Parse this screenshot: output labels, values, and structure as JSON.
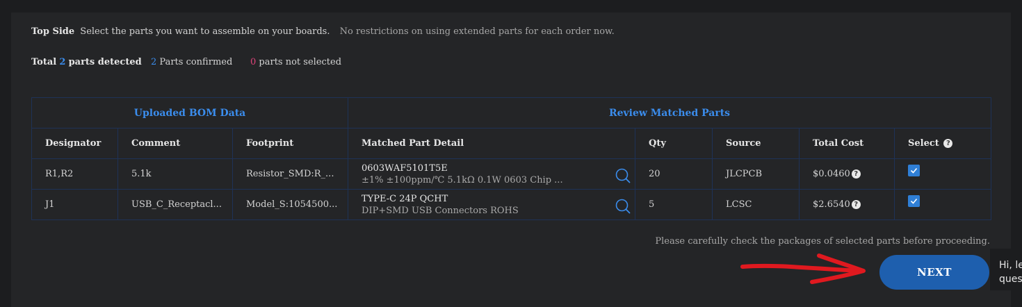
{
  "header": {
    "side": "Top Side",
    "instruction": "Select the parts you want to assemble on your boards.",
    "note": "No restrictions on using extended parts for each order now."
  },
  "summary": {
    "total_prefix": "Total",
    "total_count": "2",
    "total_suffix": "parts detected",
    "confirmed_count": "2",
    "confirmed_label": "Parts confirmed",
    "not_selected_count": "0",
    "not_selected_label": "parts not selected"
  },
  "table": {
    "group_left": "Uploaded BOM Data",
    "group_right": "Review Matched Parts",
    "columns": [
      "Designator",
      "Comment",
      "Footprint",
      "Matched Part Detail",
      "Qty",
      "Source",
      "Total Cost",
      "Select"
    ],
    "rows": [
      {
        "designator": "R1,R2",
        "comment": "5.1k",
        "footprint": "Resistor_SMD:R_...",
        "part_title": "0603WAF5101T5E",
        "part_desc": "±1% ±100ppm/℃ 5.1kΩ 0.1W 0603 Chip ...",
        "qty": "20",
        "source": "JLCPCB",
        "cost": "$0.0460",
        "selected": true
      },
      {
        "designator": "J1",
        "comment": "USB_C_Receptacl...",
        "footprint": "Model_S:1054500...",
        "part_title": "TYPE-C 24P QCHT",
        "part_desc": "DIP+SMD USB Connectors ROHS",
        "qty": "5",
        "source": "LCSC",
        "cost": "$2.6540",
        "selected": true
      }
    ]
  },
  "footer": {
    "careful_note": "Please carefully check the packages of selected parts before proceeding.",
    "next_label": "NEXT"
  },
  "chat": {
    "line1": "Hi, le",
    "line2": "quest"
  },
  "colors": {
    "accent": "#3b8ded",
    "pink": "#e0437a",
    "button": "#1e5fae",
    "annotation_arrow": "#e0191f"
  },
  "icons": [
    "search-icon",
    "help-icon",
    "checkbox-checked-icon",
    "red-arrow-annotation"
  ]
}
